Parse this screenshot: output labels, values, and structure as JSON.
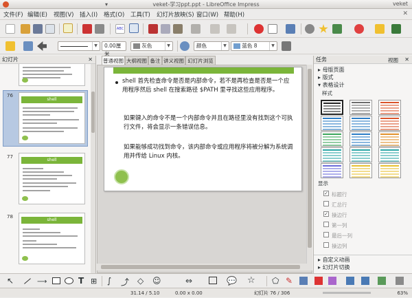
{
  "window": {
    "title": "veket-学习ppt.ppt - LibreOffice Impress",
    "app_name": "veket"
  },
  "menu": [
    "文件(F)",
    "编辑(E)",
    "视图(V)",
    "插入(I)",
    "格式(O)",
    "工具(T)",
    "幻灯片放映(S)",
    "窗口(W)",
    "帮助(H)"
  ],
  "format_bar": {
    "line_width": "0.00厘米",
    "area_style": "灰色",
    "fill_mode": "颜色",
    "fill_color": "蓝色 8"
  },
  "slide_panel": {
    "title": "幻灯片",
    "slides": [
      {
        "number": "76",
        "title": "shell"
      },
      {
        "number": "77",
        "title": "shell"
      },
      {
        "number": "78",
        "title": "shell"
      }
    ]
  },
  "view_tabs": [
    "普通视图",
    "大纲视图",
    "备注",
    "讲义视图",
    "幻灯片浏览"
  ],
  "slide": {
    "bullet_text": "shell 首先检查命令是否是内部命令，若不是再检查是否是一个应用程序然后 shell 在搜索路径 $PATH 里寻找这些应用程序。",
    "para1": "如果键入的命令不是一个内部命令并且在路径里没有找到这个可执行文件，将会显示一条错误信息。",
    "para2": "如果能够成功找到命令，该内部命令或应用程序将被分解为系统调用并传给 Linux 内核。"
  },
  "task_pane": {
    "title": "任务",
    "view_menu": "视图",
    "sections": [
      "母版页面",
      "版式",
      "表格设计"
    ],
    "styles_label": "样式",
    "options_label": "显示",
    "options": [
      {
        "label": "标题行",
        "checked": true
      },
      {
        "label": "汇总行",
        "checked": false
      },
      {
        "label": "操边行",
        "checked": true
      },
      {
        "label": "第一列",
        "checked": false
      },
      {
        "label": "最后一列",
        "checked": false
      },
      {
        "label": "操边列",
        "checked": false
      }
    ],
    "bottom_sections": [
      "自定义动画",
      "幻灯片切换"
    ],
    "colors": {
      "black": "#222222",
      "gray": "#6b6b6b",
      "red": "#d9532a",
      "blue": "#2a7bc4",
      "green": "#3aa55a",
      "teal": "#2aa5a5",
      "purple": "#6b6bd9",
      "yellow": "#e8c030",
      "orange": "#e0902a"
    }
  },
  "status": {
    "position": "31.14 / 5.10",
    "size": "0.00 x 0.00",
    "slide_info": "幻灯片 76 / 306",
    "zoom": "63%"
  }
}
